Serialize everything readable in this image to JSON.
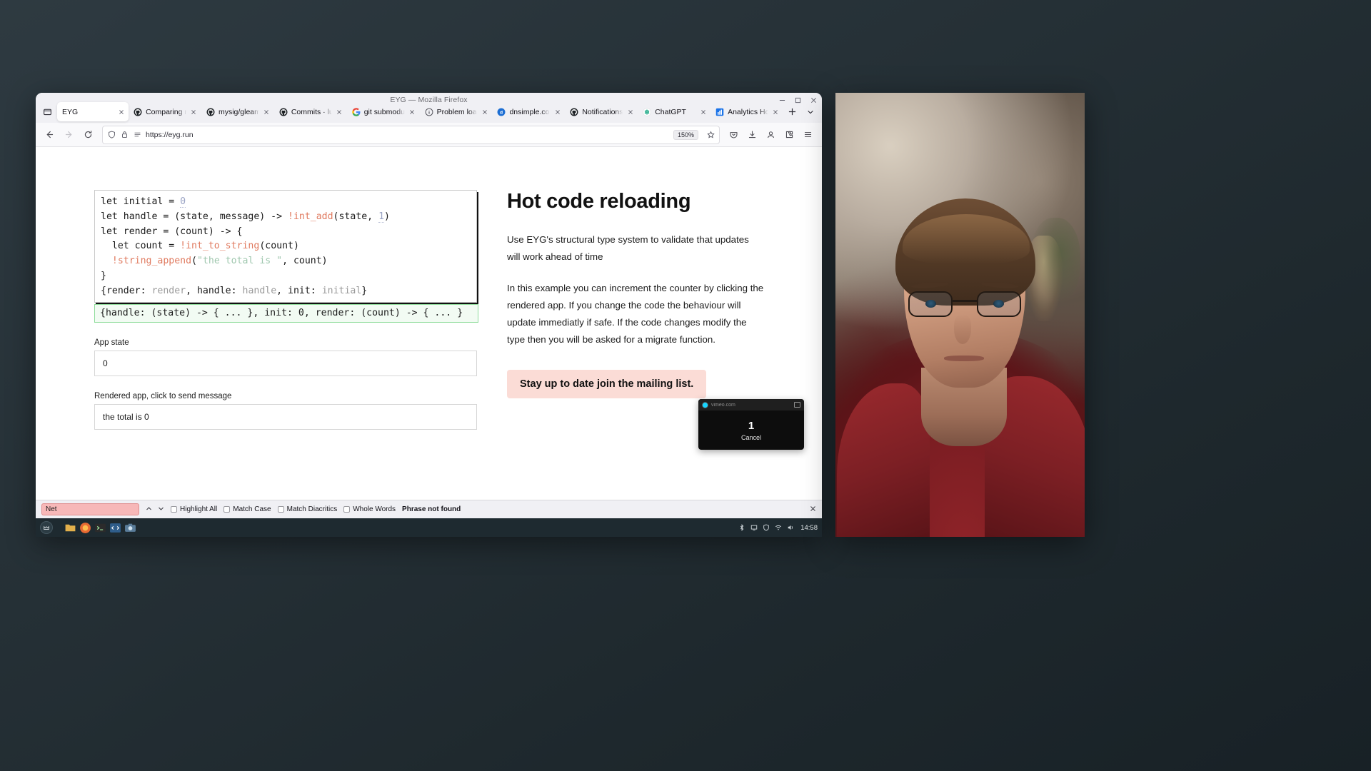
{
  "desktop": {
    "wallpaper_color": "#26313a"
  },
  "browser": {
    "window_title": "EYG — Mozilla Firefox",
    "tabs": [
      {
        "label": "EYG",
        "favicon": "none",
        "active": true
      },
      {
        "label": "Comparing main...h",
        "favicon": "github",
        "active": false
      },
      {
        "label": "mysig/gleam.toml a",
        "favicon": "github",
        "active": false
      },
      {
        "label": "Commits · lustre-lab",
        "favicon": "github",
        "active": false
      },
      {
        "label": "git submodule is m",
        "favicon": "google",
        "active": false
      },
      {
        "label": "Problem loading pa",
        "favicon": "warning",
        "active": false
      },
      {
        "label": "dnsimple.com/oaut",
        "favicon": "dnsimple",
        "active": false
      },
      {
        "label": "Notifications",
        "favicon": "github",
        "active": false
      },
      {
        "label": "ChatGPT",
        "favicon": "openai",
        "active": false
      },
      {
        "label": "Analytics Home",
        "favicon": "analytics",
        "active": false
      }
    ],
    "new_tab_label": "+",
    "toolbar": {
      "back_icon": "back-arrow-icon",
      "forward_icon": "forward-arrow-icon",
      "reload_icon": "reload-icon",
      "shield_icon": "shield-icon",
      "lock_icon": "lock-icon",
      "reader_icon": "reader-view-icon",
      "url": "https://eyg.run",
      "zoom_level": "150%",
      "bookmark_icon": "star-icon",
      "save_to_pocket_icon": "pocket-icon",
      "downloads_icon": "download-icon",
      "account_icon": "account-icon",
      "extensions_icon": "extensions-icon",
      "menu_icon": "hamburger-menu-icon"
    },
    "window_controls": {
      "minimize": "minimize-icon",
      "maximize": "maximize-icon",
      "close": "close-icon"
    }
  },
  "page": {
    "code_editor": {
      "lines": [
        [
          {
            "t": "let initial = ",
            "c": "k"
          },
          {
            "t": "0",
            "c": "num"
          }
        ],
        [
          {
            "t": "let handle = (state, message) -> ",
            "c": "k"
          },
          {
            "t": "!int_add",
            "c": "eff"
          },
          {
            "t": "(state, ",
            "c": "k"
          },
          {
            "t": "1",
            "c": "num"
          },
          {
            "t": ")",
            "c": "k"
          }
        ],
        [
          {
            "t": "let render = (count) -> {",
            "c": "k"
          }
        ],
        [
          {
            "t": "  let count = ",
            "c": "k"
          },
          {
            "t": "!int_to_string",
            "c": "eff"
          },
          {
            "t": "(count)",
            "c": "k"
          }
        ],
        [
          {
            "t": "  ",
            "c": "k"
          },
          {
            "t": "!string_append",
            "c": "eff"
          },
          {
            "t": "(",
            "c": "k"
          },
          {
            "t": "\"the total is \"",
            "c": "str"
          },
          {
            "t": ", count)",
            "c": "k"
          }
        ],
        [
          {
            "t": "}",
            "c": "k"
          }
        ],
        [
          {
            "t": "{render: ",
            "c": "k"
          },
          {
            "t": "render",
            "c": "dim"
          },
          {
            "t": ", handle: ",
            "c": "k"
          },
          {
            "t": "handle",
            "c": "dim"
          },
          {
            "t": ", init: ",
            "c": "k"
          },
          {
            "t": "initial",
            "c": "dim"
          },
          {
            "t": "}",
            "c": "k"
          }
        ]
      ],
      "result_line": "{handle: (state) -> { ... }, init: 0, render: (count) -> { ... }"
    },
    "app_state_label": "App state",
    "app_state_value": "0",
    "rendered_app_label": "Rendered app, click to send message",
    "rendered_app_value": "the total is 0",
    "heading": "Hot code reloading",
    "paragraph_1": "Use EYG's structural type system to validate that updates will work ahead of time",
    "paragraph_2": "In this example you can increment the counter by clicking the rendered app. If you change the code the behaviour will update immediatly if safe. If the code changes modify the type then you will be asked for a migrate function.",
    "mailing_button": "Stay up to date join the mailing list.",
    "mailing_button_color": "#fbdcd6"
  },
  "vimeo_player": {
    "title": "vimeo.com",
    "count": "1",
    "cancel_label": "Cancel",
    "pip_icon": "picture-in-picture-icon"
  },
  "findbar": {
    "query": "Net",
    "prev_icon": "chevron-up-icon",
    "next_icon": "chevron-down-icon",
    "highlight_all": "Highlight All",
    "match_case": "Match Case",
    "match_diacritics": "Match Diacritics",
    "whole_words": "Whole Words",
    "status": "Phrase not found",
    "close_icon": "close-icon",
    "error_color": "#f7b8b8"
  },
  "taskbar": {
    "menu_icon": "linux-mint-menu-icon",
    "apps": [
      {
        "name": "files-app",
        "icon": "folder-icon",
        "color": "#7fa84a"
      },
      {
        "name": "firefox-app",
        "icon": "firefox-icon",
        "color": "#e86a33"
      },
      {
        "name": "terminal-app",
        "icon": "terminal-icon",
        "color": "#2b2b2b"
      },
      {
        "name": "editor-app",
        "icon": "code-editor-icon",
        "color": "#3b6ea5"
      },
      {
        "name": "screenshot-app",
        "icon": "camera-icon",
        "color": "#5a7d9a"
      }
    ],
    "tray": [
      {
        "name": "bluetooth-icon"
      },
      {
        "name": "display-icon"
      },
      {
        "name": "shield-icon"
      },
      {
        "name": "network-icon"
      },
      {
        "name": "volume-icon"
      }
    ],
    "clock": "14:58"
  },
  "webcam": {
    "description": "webcam-video-feed"
  }
}
